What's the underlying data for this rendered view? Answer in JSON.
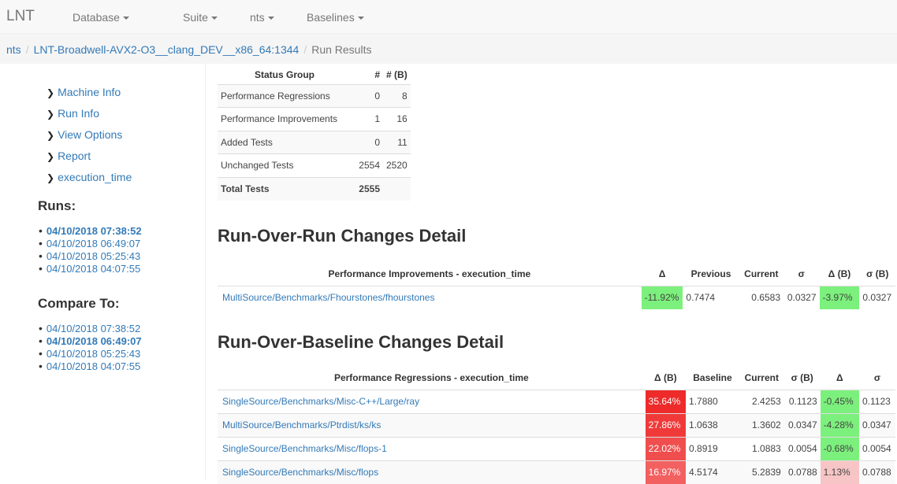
{
  "navbar": {
    "brand": "LNT",
    "items": [
      "Database",
      "Suite",
      "nts",
      "Baselines"
    ]
  },
  "breadcrumb": {
    "root": "nts",
    "machine": "LNT-Broadwell-AVX2-O3__clang_DEV__x86_64:1344",
    "current": "Run Results"
  },
  "sidebar": {
    "links": [
      "Machine Info",
      "Run Info",
      "View Options",
      "Report",
      "execution_time"
    ],
    "runs_heading": "Runs:",
    "runs": [
      "04/10/2018 07:38:52",
      "04/10/2018 06:49:07",
      "04/10/2018 05:25:43",
      "04/10/2018 04:07:55"
    ],
    "runs_selected_index": 0,
    "compare_heading": "Compare To:",
    "compare": [
      "04/10/2018 07:38:52",
      "04/10/2018 06:49:07",
      "04/10/2018 05:25:43",
      "04/10/2018 04:07:55"
    ],
    "compare_selected_index": 1
  },
  "status_table": {
    "headers": [
      "Status Group",
      "#",
      "# (B)"
    ],
    "rows": [
      [
        "Performance Regressions",
        "0",
        "8"
      ],
      [
        "Performance Improvements",
        "1",
        "16"
      ],
      [
        "Added Tests",
        "0",
        "11"
      ],
      [
        "Unchanged Tests",
        "2554",
        "2520"
      ],
      [
        "Total Tests",
        "2555",
        ""
      ]
    ]
  },
  "run_over_run": {
    "title": "Run-Over-Run Changes Detail",
    "headers": [
      "Performance Improvements - execution_time",
      "Δ",
      "Previous",
      "Current",
      "σ",
      "Δ (B)",
      "σ (B)"
    ],
    "rows": [
      [
        "MultiSource/Benchmarks/Fhourstones/fhourstones",
        "-11.92%",
        "0.7474",
        "0.6583",
        "0.0327",
        "-3.97%",
        "0.0327"
      ]
    ]
  },
  "run_over_baseline": {
    "title": "Run-Over-Baseline Changes Detail",
    "headers": [
      "Performance Regressions - execution_time",
      "Δ (B)",
      "Baseline",
      "Current",
      "σ (B)",
      "Δ",
      "σ"
    ],
    "rows": [
      [
        "SingleSource/Benchmarks/Misc-C++/Large/ray",
        "35.64%",
        "1.7880",
        "2.4253",
        "0.1123",
        "-0.45%",
        "0.1123"
      ],
      [
        "MultiSource/Benchmarks/Ptrdist/ks/ks",
        "27.86%",
        "1.0638",
        "1.3602",
        "0.0347",
        "-4.28%",
        "0.0347"
      ],
      [
        "SingleSource/Benchmarks/Misc/flops-1",
        "22.02%",
        "0.8919",
        "1.0883",
        "0.0054",
        "-0.68%",
        "0.0054"
      ],
      [
        "SingleSource/Benchmarks/Misc/flops",
        "16.97%",
        "4.5174",
        "5.2839",
        "0.0788",
        "1.13%",
        "0.0788"
      ]
    ]
  },
  "colors": {
    "link": "#337ab7",
    "improvement": "#7cf07c",
    "regression_strong": "#f03030",
    "regression_mild": "#f7c5c5"
  }
}
